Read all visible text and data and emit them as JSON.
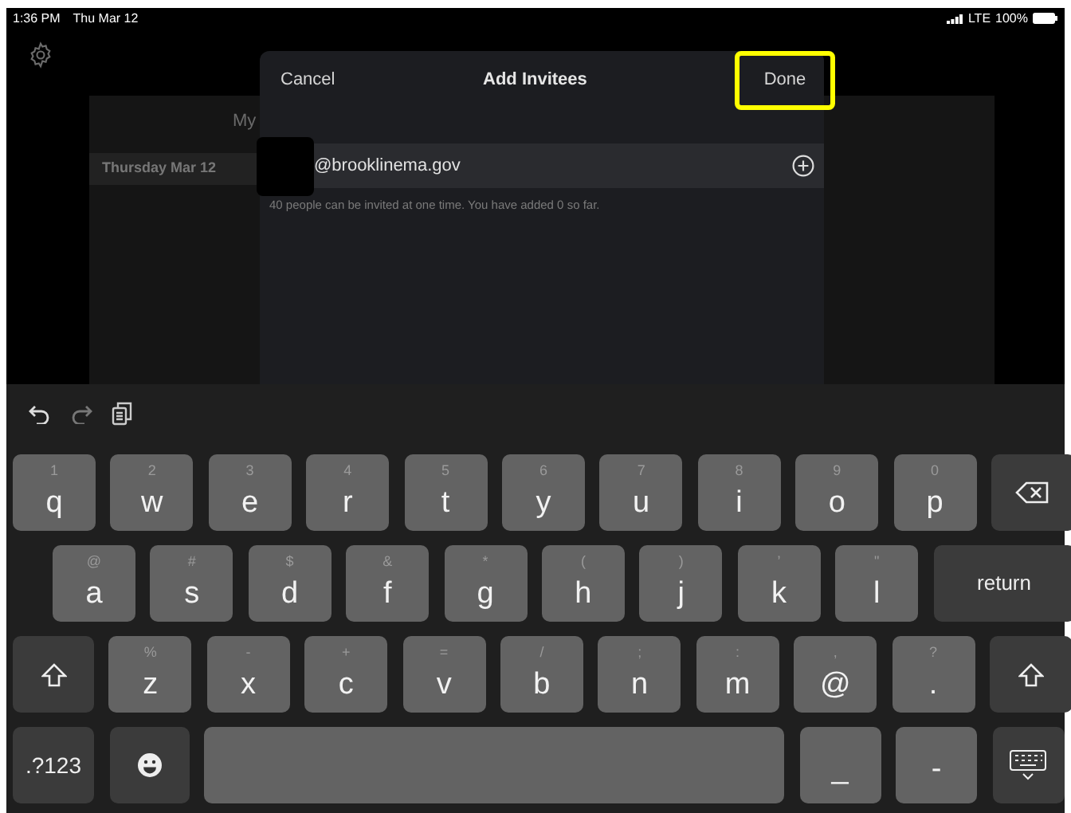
{
  "status_bar": {
    "time": "1:36 PM",
    "date": "Thu Mar 12",
    "network": "LTE",
    "battery": "100%"
  },
  "background": {
    "heading": "My",
    "date_row": "Thursday Mar 12"
  },
  "modal": {
    "cancel": "Cancel",
    "title": "Add Invitees",
    "done": {
      "label": "Done",
      "highlighted": true
    },
    "field": {
      "value": "@brooklinema.gov",
      "redacted": true
    },
    "hint": "40 people can be invited at one time. You have added 0 so far."
  },
  "keyboard": {
    "rows": [
      {
        "keys": [
          {
            "kind": "char",
            "label": "q",
            "hint": "1"
          },
          {
            "kind": "char",
            "label": "w",
            "hint": "2"
          },
          {
            "kind": "char",
            "label": "e",
            "hint": "3"
          },
          {
            "kind": "char",
            "label": "r",
            "hint": "4"
          },
          {
            "kind": "char",
            "label": "t",
            "hint": "5"
          },
          {
            "kind": "char",
            "label": "y",
            "hint": "6"
          },
          {
            "kind": "char",
            "label": "u",
            "hint": "7"
          },
          {
            "kind": "char",
            "label": "i",
            "hint": "8"
          },
          {
            "kind": "char",
            "label": "o",
            "hint": "9"
          },
          {
            "kind": "char",
            "label": "p",
            "hint": "0"
          },
          {
            "kind": "backspace"
          }
        ]
      },
      {
        "keys": [
          {
            "kind": "char",
            "label": "a",
            "hint": "@"
          },
          {
            "kind": "char",
            "label": "s",
            "hint": "#"
          },
          {
            "kind": "char",
            "label": "d",
            "hint": "$"
          },
          {
            "kind": "char",
            "label": "f",
            "hint": "&"
          },
          {
            "kind": "char",
            "label": "g",
            "hint": "*"
          },
          {
            "kind": "char",
            "label": "h",
            "hint": "("
          },
          {
            "kind": "char",
            "label": "j",
            "hint": ")"
          },
          {
            "kind": "char",
            "label": "k",
            "hint": "’"
          },
          {
            "kind": "char",
            "label": "l",
            "hint": "\""
          },
          {
            "kind": "return",
            "label": "return"
          }
        ]
      },
      {
        "keys": [
          {
            "kind": "shift"
          },
          {
            "kind": "char",
            "label": "z",
            "hint": "%"
          },
          {
            "kind": "char",
            "label": "x",
            "hint": "-"
          },
          {
            "kind": "char",
            "label": "c",
            "hint": "+"
          },
          {
            "kind": "char",
            "label": "v",
            "hint": "="
          },
          {
            "kind": "char",
            "label": "b",
            "hint": "/"
          },
          {
            "kind": "char",
            "label": "n",
            "hint": ";"
          },
          {
            "kind": "char",
            "label": "m",
            "hint": ":"
          },
          {
            "kind": "char",
            "label": "@",
            "hint": ","
          },
          {
            "kind": "char",
            "label": ".",
            "hint": "?"
          },
          {
            "kind": "shift"
          }
        ]
      },
      {
        "keys": [
          {
            "kind": "mode",
            "label": ".?123"
          },
          {
            "kind": "emoji"
          },
          {
            "kind": "space"
          },
          {
            "kind": "char",
            "label": "_"
          },
          {
            "kind": "char",
            "label": "-"
          },
          {
            "kind": "dismiss"
          }
        ]
      }
    ]
  }
}
